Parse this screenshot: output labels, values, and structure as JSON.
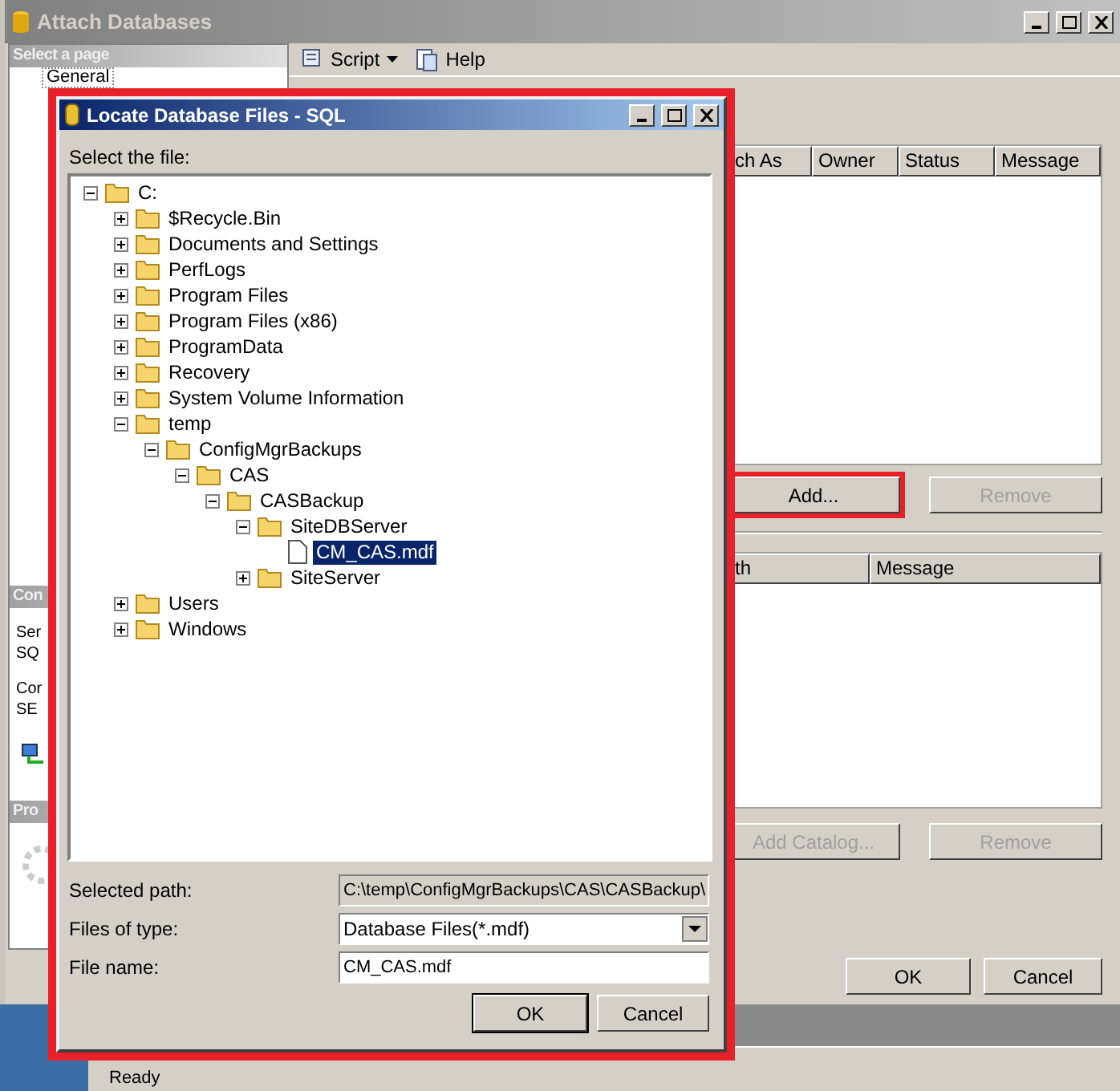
{
  "main_window": {
    "title": "Attach Databases",
    "sidebar": {
      "header": "Select a page",
      "items": [
        {
          "label": "General",
          "selected": true
        }
      ]
    },
    "sidebar_lower": {
      "connection_header": "Con",
      "texts": [
        "Ser",
        "SQ",
        "Cor",
        "SE"
      ],
      "progress_header": "Pro"
    },
    "toolbar": [
      {
        "label": "Script",
        "kind": "dropdown"
      },
      {
        "label": "Help",
        "kind": "button"
      }
    ],
    "databases_table": {
      "columns": [
        "ch As",
        "Owner",
        "Status",
        "Message"
      ]
    },
    "database_buttons": [
      {
        "label": "Add...",
        "disabled": false,
        "highlighted": true
      },
      {
        "label": "Remove",
        "disabled": true,
        "highlighted": false
      }
    ],
    "details_table": {
      "columns": [
        "th",
        "Message"
      ]
    },
    "details_buttons": [
      {
        "label": "Add Catalog...",
        "disabled": true
      },
      {
        "label": "Remove",
        "disabled": true
      }
    ],
    "buttons": [
      "OK",
      "Cancel"
    ],
    "status_bar": "Ready"
  },
  "locate_dialog": {
    "title": "Locate Database Files - SQL",
    "highlighted": true,
    "prompt": "Select the file:",
    "tree": [
      {
        "label": "C:",
        "kind": "folder",
        "expanded": true,
        "children": [
          {
            "label": "$Recycle.Bin",
            "kind": "folder",
            "expanded": false
          },
          {
            "label": "Documents and Settings",
            "kind": "folder",
            "expanded": false
          },
          {
            "label": "PerfLogs",
            "kind": "folder",
            "expanded": false
          },
          {
            "label": "Program Files",
            "kind": "folder",
            "expanded": false
          },
          {
            "label": "Program Files (x86)",
            "kind": "folder",
            "expanded": false
          },
          {
            "label": "ProgramData",
            "kind": "folder",
            "expanded": false
          },
          {
            "label": "Recovery",
            "kind": "folder",
            "expanded": false
          },
          {
            "label": "System Volume Information",
            "kind": "folder",
            "expanded": false
          },
          {
            "label": "temp",
            "kind": "folder",
            "expanded": true,
            "children": [
              {
                "label": "ConfigMgrBackups",
                "kind": "folder",
                "expanded": true,
                "children": [
                  {
                    "label": "CAS",
                    "kind": "folder",
                    "expanded": true,
                    "children": [
                      {
                        "label": "CASBackup",
                        "kind": "folder",
                        "expanded": true,
                        "children": [
                          {
                            "label": "SiteDBServer",
                            "kind": "folder",
                            "expanded": true,
                            "children": [
                              {
                                "label": "CM_CAS.mdf",
                                "kind": "file",
                                "selected": true
                              }
                            ]
                          },
                          {
                            "label": "SiteServer",
                            "kind": "folder",
                            "expanded": false
                          }
                        ]
                      }
                    ]
                  }
                ]
              }
            ]
          },
          {
            "label": "Users",
            "kind": "folder",
            "expanded": false
          },
          {
            "label": "Windows",
            "kind": "folder",
            "expanded": false
          }
        ]
      }
    ],
    "selected_path": {
      "label": "Selected path:",
      "value": "C:\\temp\\ConfigMgrBackups\\CAS\\CASBackup\\"
    },
    "files_of_type": {
      "label": "Files of type:",
      "value": "Database Files(*.mdf)"
    },
    "file_name": {
      "label": "File name:",
      "value": "CM_CAS.mdf"
    },
    "buttons": [
      "OK",
      "Cancel"
    ]
  }
}
